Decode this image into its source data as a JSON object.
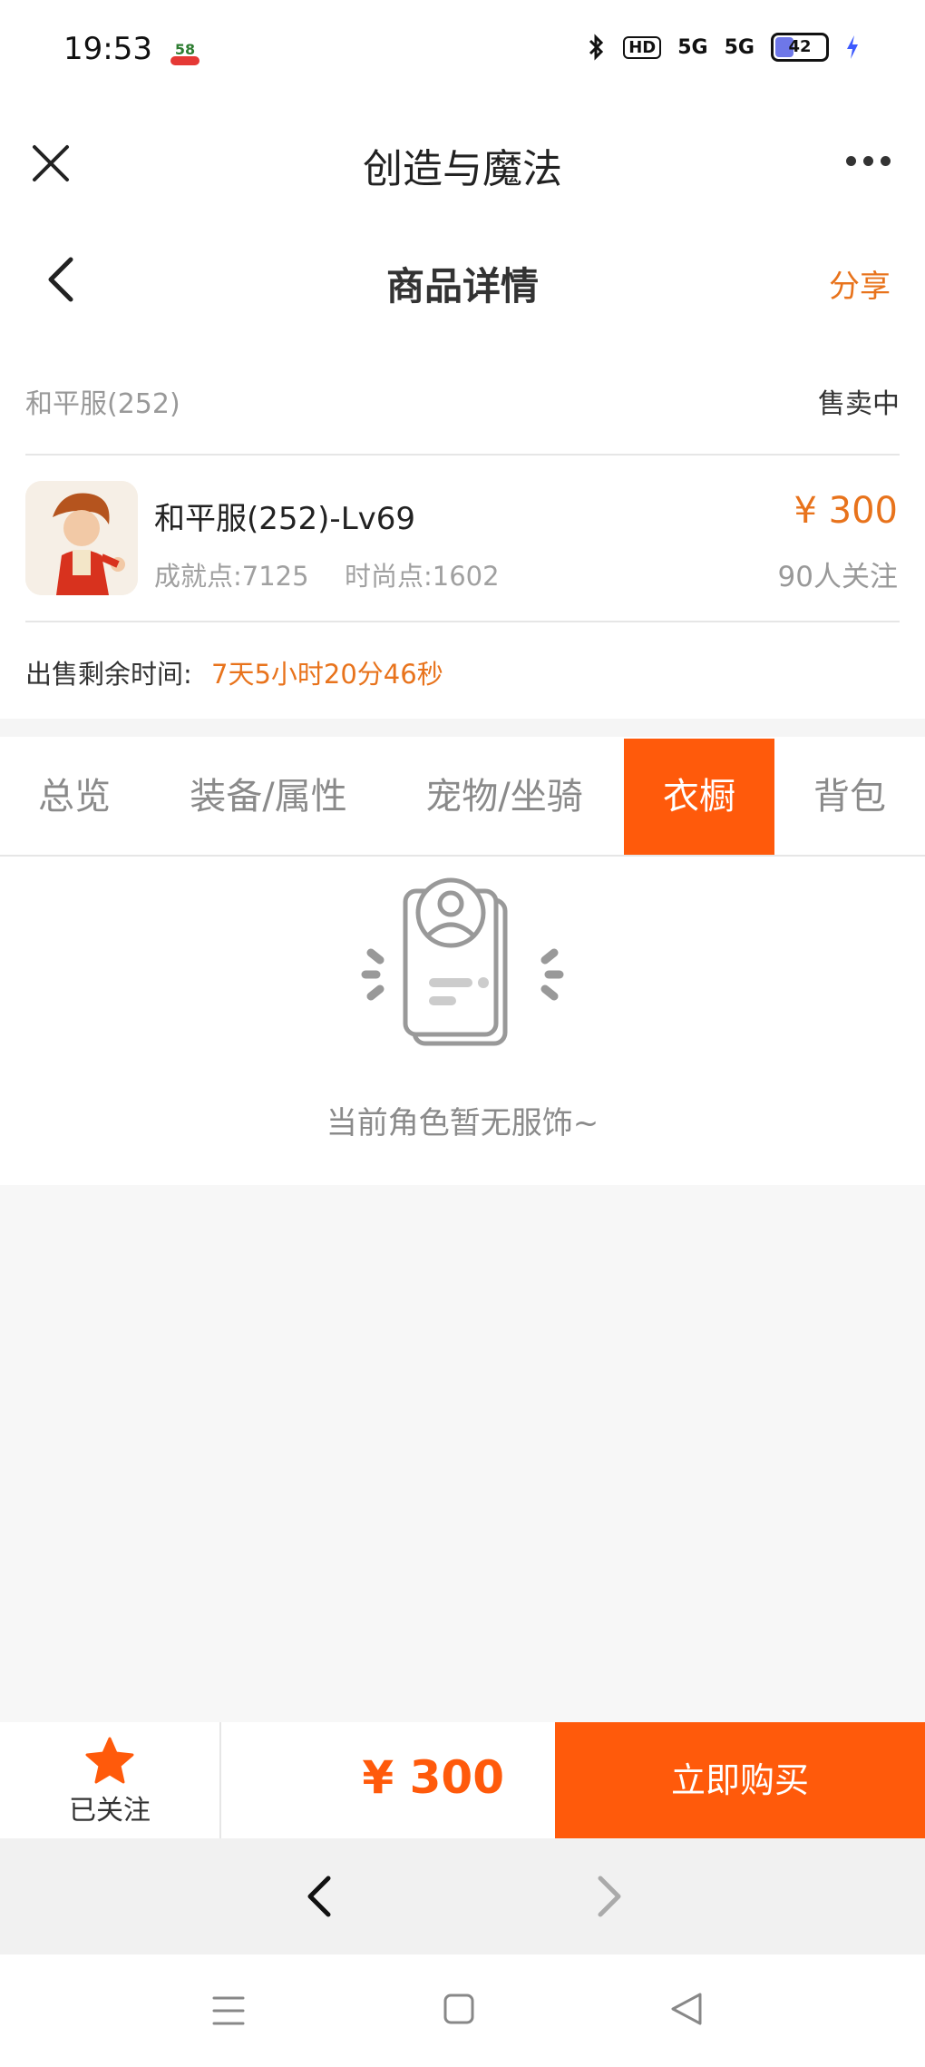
{
  "status_bar": {
    "time": "19:53",
    "app_badge": "58",
    "hd_label": "HD",
    "signal1": "5G",
    "signal2": "5G",
    "battery": "42"
  },
  "titlebar": {
    "title": "创造与魔法"
  },
  "navbar": {
    "title": "商品详情",
    "share_label": "分享"
  },
  "product": {
    "server_label": "和平服(252)",
    "status": "售卖中",
    "name": "和平服(252)-Lv69",
    "achievement": "成就点:7125",
    "fashion": "时尚点:1602",
    "price": "¥ 300",
    "followers": "90人关注",
    "timer_label": "出售剩余时间:",
    "timer_value": "7天5小时20分46秒"
  },
  "tabs": [
    {
      "label": "总览",
      "active": false
    },
    {
      "label": "装备/属性",
      "active": false
    },
    {
      "label": "宠物/坐骑",
      "active": false
    },
    {
      "label": "衣橱",
      "active": true
    },
    {
      "label": "背包",
      "active": false
    }
  ],
  "empty_state": {
    "text": "当前角色暂无服饰~"
  },
  "bottom_bar": {
    "follow_label": "已关注",
    "price": "¥ 300",
    "buy_label": "立即购买"
  },
  "colors": {
    "accent": "#ff5a0b",
    "accent_text": "#e8731c"
  }
}
